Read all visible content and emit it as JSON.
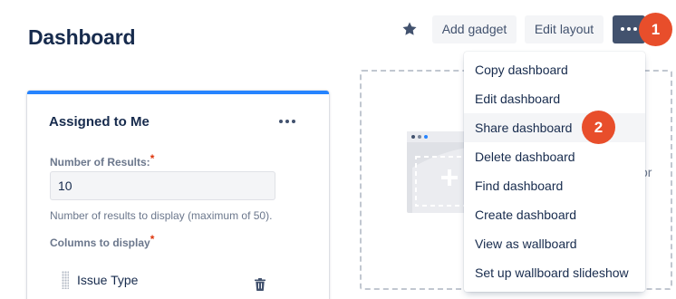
{
  "header": {
    "title": "Dashboard",
    "star_icon": "star-icon",
    "add_gadget_label": "Add gadget",
    "edit_layout_label": "Edit layout",
    "more_icon": "more-horizontal-icon"
  },
  "callouts": {
    "step1": "1",
    "step2": "2",
    "color": "#e84e2b"
  },
  "gadget": {
    "title": "Assigned to Me",
    "more_icon": "more-horizontal-icon",
    "results_label": "Number of Results:",
    "required_mark": "*",
    "results_value": "10",
    "results_help": "Number of results to display (maximum of 50).",
    "columns_label": "Columns to display",
    "columns": [
      {
        "name": "Issue Type",
        "icon": "trash-icon"
      }
    ],
    "accent": "#2684ff"
  },
  "drop_zone": {
    "partial_text": "or"
  },
  "menu": {
    "items": [
      {
        "label": "Copy dashboard"
      },
      {
        "label": "Edit dashboard"
      },
      {
        "label": "Share dashboard",
        "highlighted": true
      },
      {
        "label": "Delete dashboard"
      },
      {
        "label": "Find dashboard"
      },
      {
        "label": "Create dashboard"
      },
      {
        "label": "View as wallboard"
      },
      {
        "label": "Set up wallboard slideshow"
      }
    ]
  }
}
